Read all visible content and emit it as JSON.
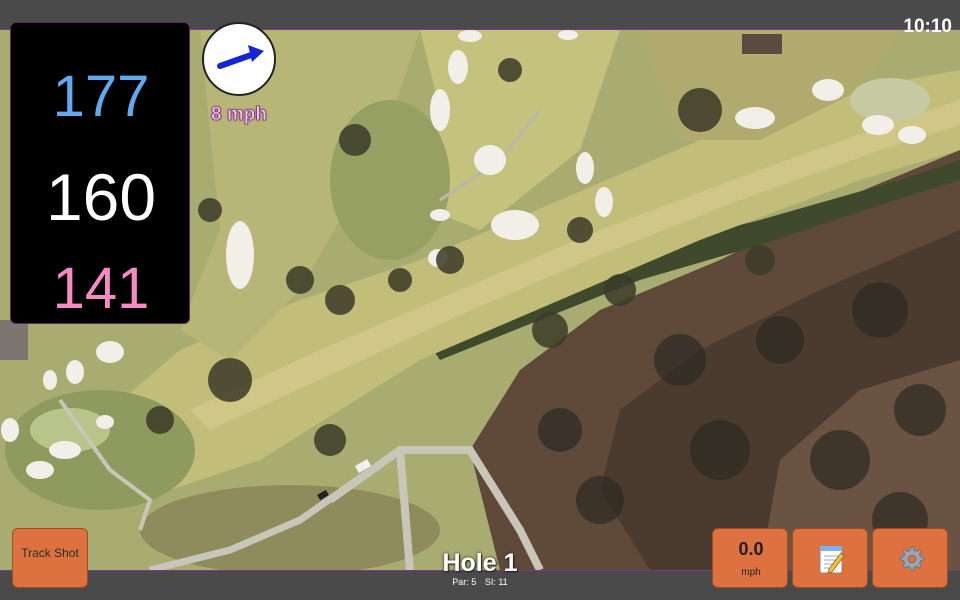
{
  "status": {
    "time": "10:10"
  },
  "distances": {
    "back": "177",
    "middle": "160",
    "front": "141"
  },
  "wind": {
    "speed": "8 mph",
    "direction": "east-north-east",
    "icon": "wind-arrow-icon"
  },
  "hole": {
    "title": "Hole 1",
    "par": "Par: 5",
    "si": "SI: 11"
  },
  "buttons": {
    "track_shot": "Track Shot",
    "speed_value": "0.0",
    "speed_unit": "mph",
    "notes_icon": "notepad-icon",
    "settings_icon": "gear-icon"
  },
  "colors": {
    "back_distance": "#62aaf0",
    "middle_distance": "#ffffff",
    "front_distance": "#f58ac5",
    "button": "#dd7240",
    "wind_arrow": "#1426d8"
  }
}
